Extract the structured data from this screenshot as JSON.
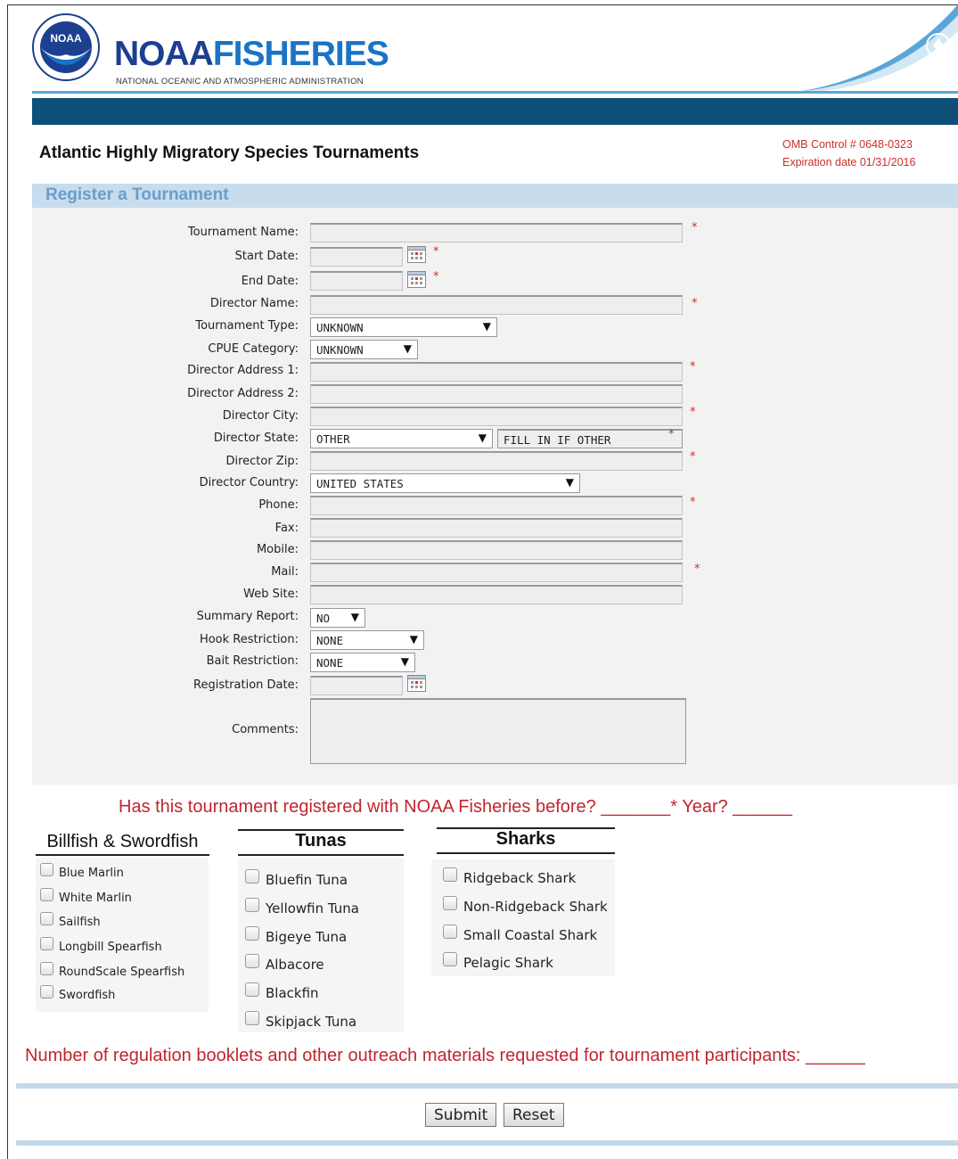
{
  "header": {
    "seal_text": "NOAA",
    "brand_part1": "NOAA",
    "brand_part2": "FISHERIES",
    "brand_subtitle": "NATIONAL OCEANIC AND ATMOSPHERIC ADMINISTRATION"
  },
  "page": {
    "title": "Atlantic Highly Migratory Species Tournaments",
    "omb_control": "OMB Control # 0648-0323",
    "expiration": "Expiration date 01/31/2016",
    "section_title": "Register a Tournament"
  },
  "form": {
    "tournament_name_label": "Tournament Name:",
    "start_date_label": "Start Date:",
    "end_date_label": "End Date:",
    "director_name_label": "Director Name:",
    "tournament_type_label": "Tournament Type:",
    "tournament_type_value": "UNKNOWN",
    "cpue_label": "CPUE Category:",
    "cpue_value": "UNKNOWN",
    "address1_label": "Director Address 1:",
    "address2_label": "Director Address 2:",
    "city_label": "Director City:",
    "state_label": "Director State:",
    "state_value": "OTHER",
    "state_other_value": "FILL IN IF OTHER",
    "zip_label": "Director Zip:",
    "country_label": "Director Country:",
    "country_value": "UNITED STATES",
    "phone_label": "Phone:",
    "fax_label": "Fax:",
    "mobile_label": "Mobile:",
    "mail_label": "Mail:",
    "website_label": "Web Site:",
    "summary_label": "Summary Report:",
    "summary_value": "NO",
    "hook_label": "Hook Restriction:",
    "hook_value": "NONE",
    "bait_label": "Bait Restriction:",
    "bait_value": "NONE",
    "registration_date_label": "Registration Date:",
    "comments_label": "Comments:",
    "required_mark": "*",
    "dropdown_arrow": "▼"
  },
  "question": {
    "text": "Has this tournament registered with NOAA Fisheries before? _______* Year? ______"
  },
  "species": {
    "billfish": {
      "title": "Billfish & Swordfish",
      "items": [
        "Blue Marlin",
        "White Marlin",
        "Sailfish",
        "Longbill Spearfish",
        "RoundScale Spearfish",
        "Swordfish"
      ]
    },
    "tunas": {
      "title": "Tunas",
      "items": [
        "Bluefin Tuna",
        "Yellowfin Tuna",
        "Bigeye Tuna",
        "Albacore",
        "Blackfin",
        "Skipjack Tuna"
      ]
    },
    "sharks": {
      "title": "Sharks",
      "items": [
        "Ridgeback Shark",
        "Non-Ridgeback Shark",
        "Small Coastal Shark",
        "Pelagic Shark"
      ]
    }
  },
  "booklets": {
    "text": "Number of regulation booklets and other outreach materials requested for tournament participants: ______"
  },
  "buttons": {
    "submit": "Submit",
    "reset": "Reset"
  },
  "colors": {
    "navbar": "#0d4f78",
    "brand_dark": "#1c3f8f",
    "brand_light": "#1a73c6",
    "section_bg": "#c7dcec",
    "section_text": "#6a9ec9",
    "required_red": "#c9302c",
    "question_red": "#c0262e"
  }
}
